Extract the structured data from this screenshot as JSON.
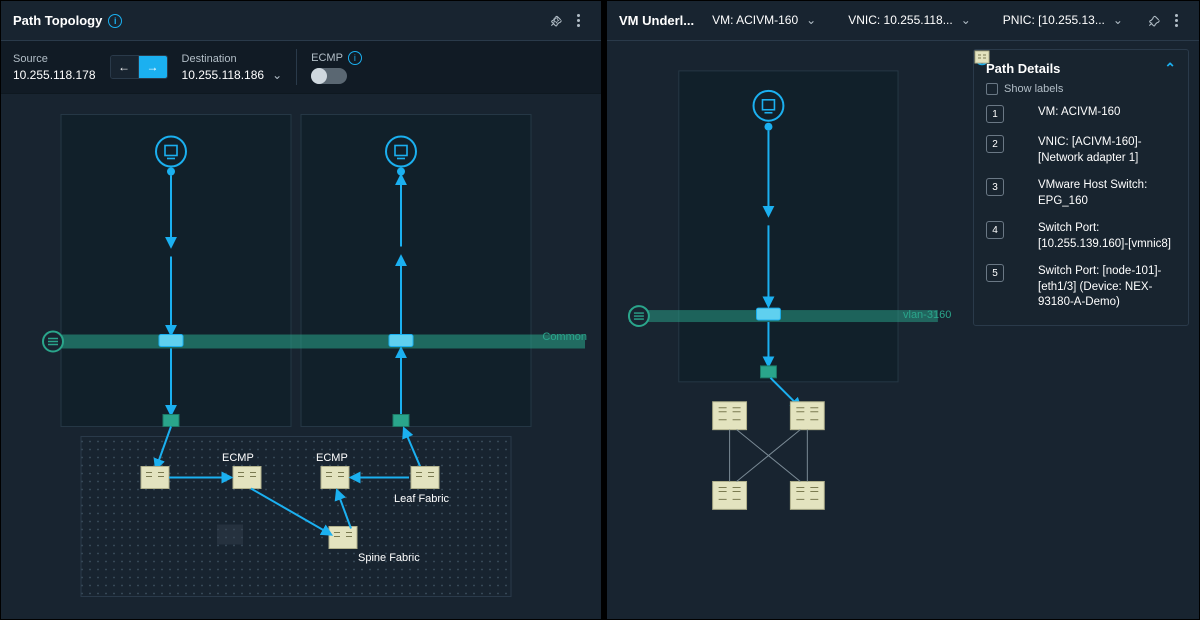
{
  "left": {
    "title": "Path Topology",
    "toolbar": {
      "source_label": "Source",
      "source_value": "10.255.118.178",
      "dest_label": "Destination",
      "dest_value": "10.255.118.186",
      "ecmp_label": "ECMP"
    },
    "labels": {
      "common": "Common",
      "ecmp1": "ECMP",
      "ecmp2": "ECMP",
      "leaf_fabric": "Leaf Fabric",
      "spine_fabric": "Spine Fabric"
    }
  },
  "right": {
    "title": "VM Underl...",
    "dropdowns": {
      "vm": "VM: ACIVM-160",
      "vnic": "VNIC: 10.255.118...",
      "pnic": "PNIC: [10.255.13..."
    },
    "vlan_label": "vlan-3160",
    "details": {
      "title": "Path Details",
      "show_labels": "Show labels",
      "steps": [
        {
          "n": "1",
          "text": "VM: ACIVM-160"
        },
        {
          "n": "2",
          "text": "VNIC: [ACIVM-160]-[Network adapter 1]"
        },
        {
          "n": "3",
          "text": "VMware Host Switch: EPG_160"
        },
        {
          "n": "4",
          "text": "Switch Port: [10.255.139.160]-[vmnic8]"
        },
        {
          "n": "5",
          "text": "Switch Port: [node-101]-[eth1/3] (Device: NEX-93180-A-Demo)"
        }
      ]
    }
  }
}
